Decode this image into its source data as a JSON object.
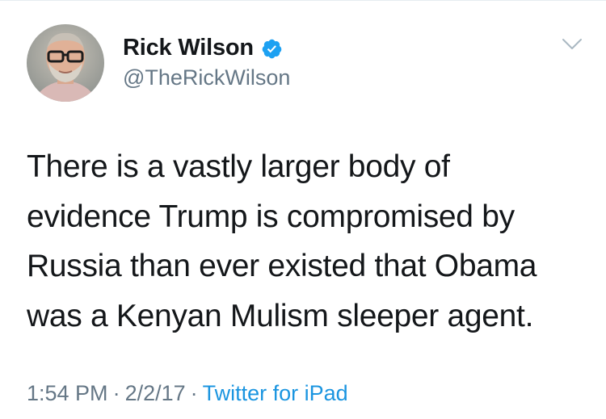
{
  "tweet": {
    "author": {
      "display_name": "Rick Wilson",
      "handle": "@TheRickWilson",
      "verified": true,
      "avatar_icon": "profile-photo"
    },
    "text_lines": [
      "There is a vastly larger body of",
      "evidence Trump is compromised by",
      "Russia than ever existed that Obama",
      "was a Kenyan Mulism sleeper agent."
    ],
    "time": "1:54 PM",
    "date": "2/2/17",
    "separator": "·",
    "source": "Twitter for iPad",
    "menu_icon": "chevron-down-icon"
  },
  "colors": {
    "text": "#14171a",
    "secondary": "#657786",
    "link": "#1b95e0",
    "verified": "#1da1f2"
  }
}
